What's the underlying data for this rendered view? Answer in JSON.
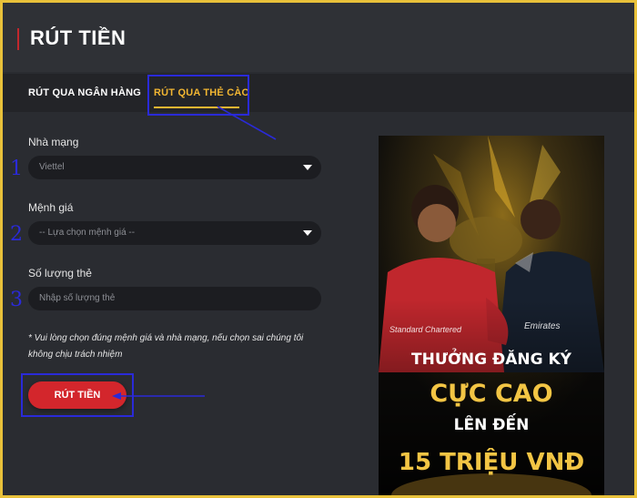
{
  "page": {
    "title": "RÚT TIỀN"
  },
  "tabs": [
    {
      "label": "RÚT QUA NGÂN HÀNG",
      "active": false
    },
    {
      "label": "RÚT QUA THẺ CÀO",
      "active": true
    }
  ],
  "form": {
    "network": {
      "label": "Nhà mạng",
      "value": "Viettel",
      "step": "1"
    },
    "denomination": {
      "label": "Mệnh giá",
      "value": "-- Lựa chọn mệnh giá --",
      "step": "2"
    },
    "quantity": {
      "label": "Số lượng thẻ",
      "placeholder": "Nhập số lượng thẻ",
      "step": "3"
    },
    "note": "* Vui lòng chọn đúng mệnh giá và nhà mạng, nếu chọn sai chúng tôi không chịu trách nhiệm",
    "submit_label": "RÚT TIỀN"
  },
  "banner": {
    "line1": "THƯỞNG ĐĂNG KÝ",
    "line2": "CỰC CAO",
    "line3": "LÊN ĐẾN",
    "line4": "15 TRIỆU VNĐ",
    "left_jersey_text": "Standard Chartered",
    "right_jersey_text": "Emirates"
  },
  "colors": {
    "frame": "#e8c13a",
    "accent": "#f2b632",
    "button": "#d3262c",
    "annotation": "#2a2ad8"
  }
}
